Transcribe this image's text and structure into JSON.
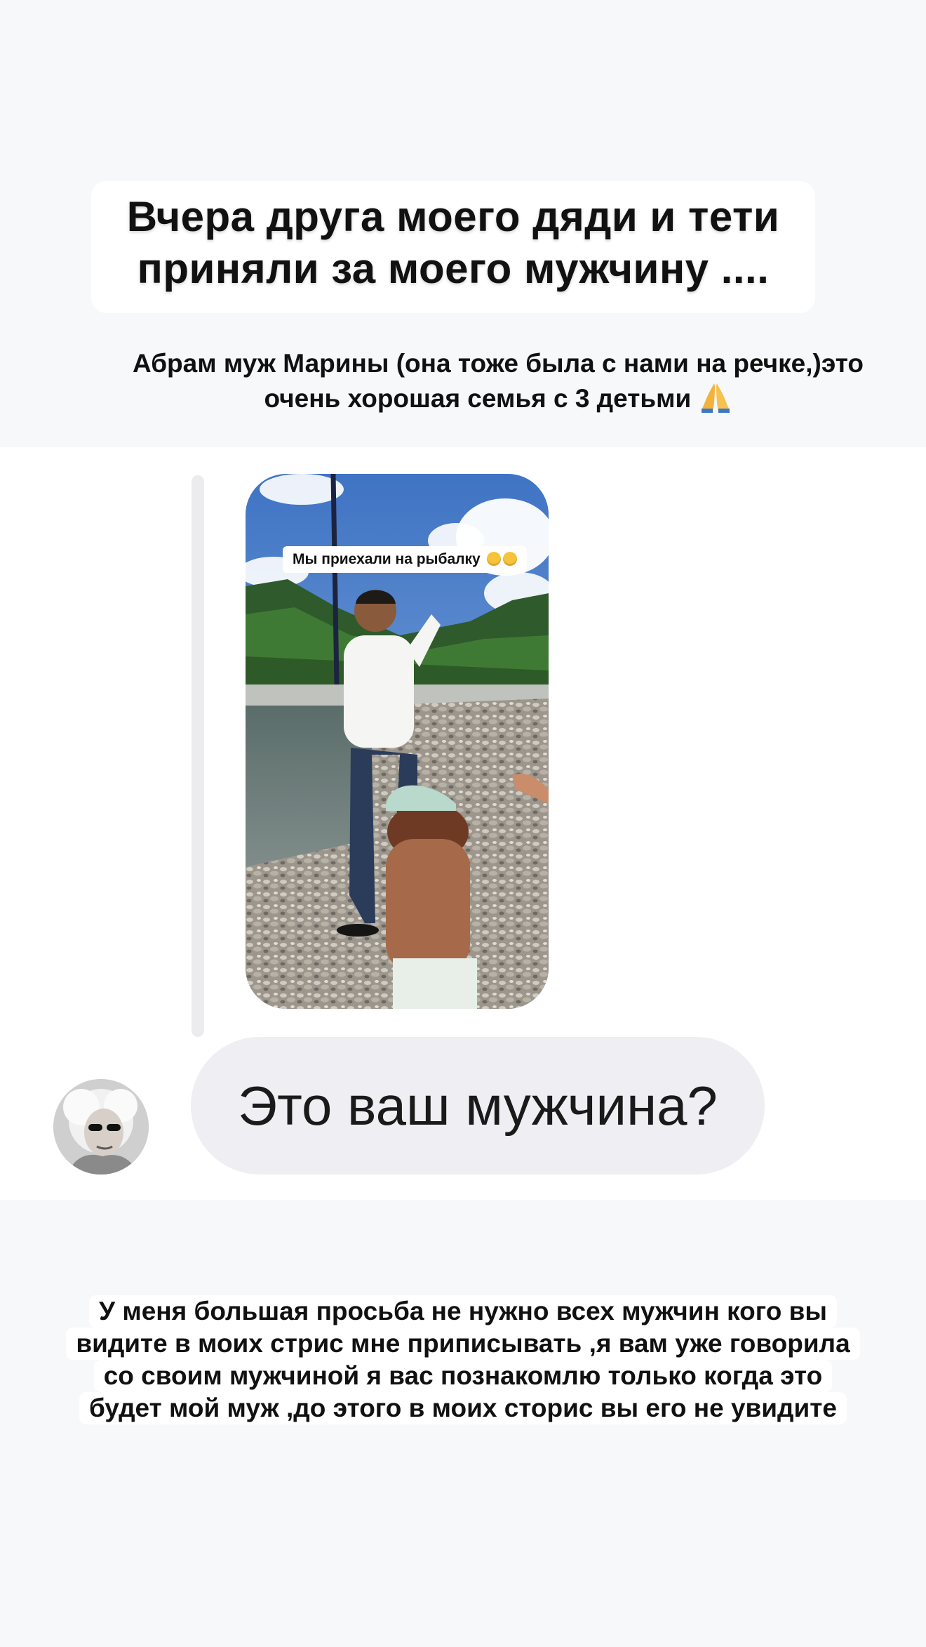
{
  "headline": {
    "line1": "Вчера друга моего дяди и тети",
    "line2": "приняли за моего мужчину ...."
  },
  "caption": {
    "line1": "Абрам муж Марины (она тоже была с нами на речке,)это",
    "line2": "очень хорошая семья с 3 детьми",
    "emoji": "folded-hands-icon"
  },
  "story_reply": {
    "sticker_text": "Мы приехали на рыбалку",
    "sticker_emoji": "laughing-emoji-icon"
  },
  "message": {
    "text": "Это ваш мужчина?"
  },
  "bottom_caption": {
    "line1": "У меня большая просьба не нужно всех мужчин кого вы",
    "line2": "видите в моих стрис  мне приписывать ,я вам уже говорила",
    "line3": "со своим  мужчиной я вас познакомлю только когда это",
    "line4": "будет мой муж ,до этого в моих сторис вы его не увидите"
  },
  "colors": {
    "background": "#f7f8fa",
    "bubble": "#efeff3",
    "text": "#111111"
  }
}
